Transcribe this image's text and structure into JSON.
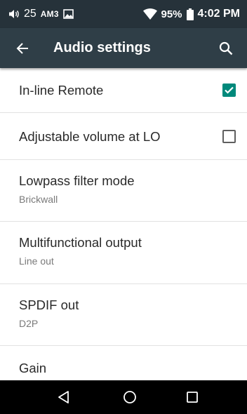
{
  "status_bar": {
    "volume_level": "25",
    "mode_label": "AM3",
    "battery_percent": "95%",
    "time": "4:02 PM",
    "icons": [
      "volume-icon",
      "image-notification-icon",
      "wifi-icon",
      "battery-icon"
    ]
  },
  "app_bar": {
    "title": "Audio settings",
    "icons": [
      "back-arrow-icon",
      "search-icon"
    ]
  },
  "settings": [
    {
      "title": "In-line Remote",
      "checked": true
    },
    {
      "title": "Adjustable volume at LO",
      "checked": false
    },
    {
      "title": "Lowpass filter mode",
      "summary": "Brickwall"
    },
    {
      "title": "Multifunctional output",
      "summary": "Line out"
    },
    {
      "title": "SPDIF out",
      "summary": "D2P"
    },
    {
      "title": "Gain"
    }
  ],
  "nav_bar": {
    "icons": [
      "back-triangle-icon",
      "home-circle-icon",
      "recents-square-icon"
    ]
  },
  "colors": {
    "status_bar_bg": "#26323a",
    "app_bar_bg": "#2f3e47",
    "checkbox_accent": "#00897b",
    "nav_bar_bg": "#000000"
  }
}
